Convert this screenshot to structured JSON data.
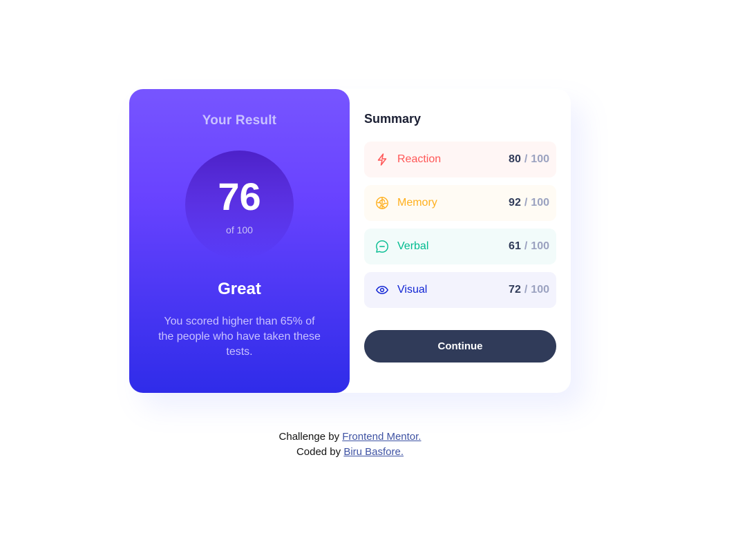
{
  "result": {
    "title": "Your Result",
    "score": "76",
    "total": "of 100",
    "rating": "Great",
    "description": "You scored higher than 65% of the people who have taken these tests."
  },
  "summary": {
    "title": "Summary",
    "items": [
      {
        "label": "Reaction",
        "score": "80",
        "max": "100",
        "icon": "lightning-icon",
        "color": "#ff5757",
        "bg": "#fff6f5"
      },
      {
        "label": "Memory",
        "score": "92",
        "max": "100",
        "icon": "brain-icon",
        "color": "#ffb01f",
        "bg": "#fffbf4"
      },
      {
        "label": "Verbal",
        "score": "61",
        "max": "100",
        "icon": "chat-bubble-icon",
        "color": "#00bb8f",
        "bg": "#f2fbfa"
      },
      {
        "label": "Visual",
        "score": "72",
        "max": "100",
        "icon": "eye-icon",
        "color": "#1125d4",
        "bg": "#f3f3fd"
      }
    ],
    "separator": "/",
    "button_label": "Continue"
  },
  "footer": {
    "challenge_prefix": "Challenge by",
    "challenge_link": "Frontend Mentor.",
    "coded_prefix": "Coded by",
    "coded_link": "Biru Basfore."
  },
  "colors": {
    "gradient_top": "#7755ff",
    "gradient_bottom": "#2f2ce9",
    "button": "#303b59"
  }
}
